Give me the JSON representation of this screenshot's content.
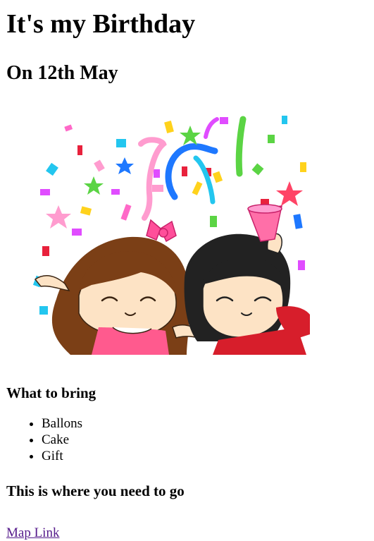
{
  "header": {
    "title": "It's my Birthday",
    "date": "On 12th May"
  },
  "illustration": {
    "icon": "birthday-party-couple-image"
  },
  "bring": {
    "heading": "What to bring",
    "items": [
      "Ballons",
      "Cake",
      "Gift"
    ]
  },
  "directions": {
    "heading": "This is where you need to go",
    "link_label": "Map Link"
  }
}
